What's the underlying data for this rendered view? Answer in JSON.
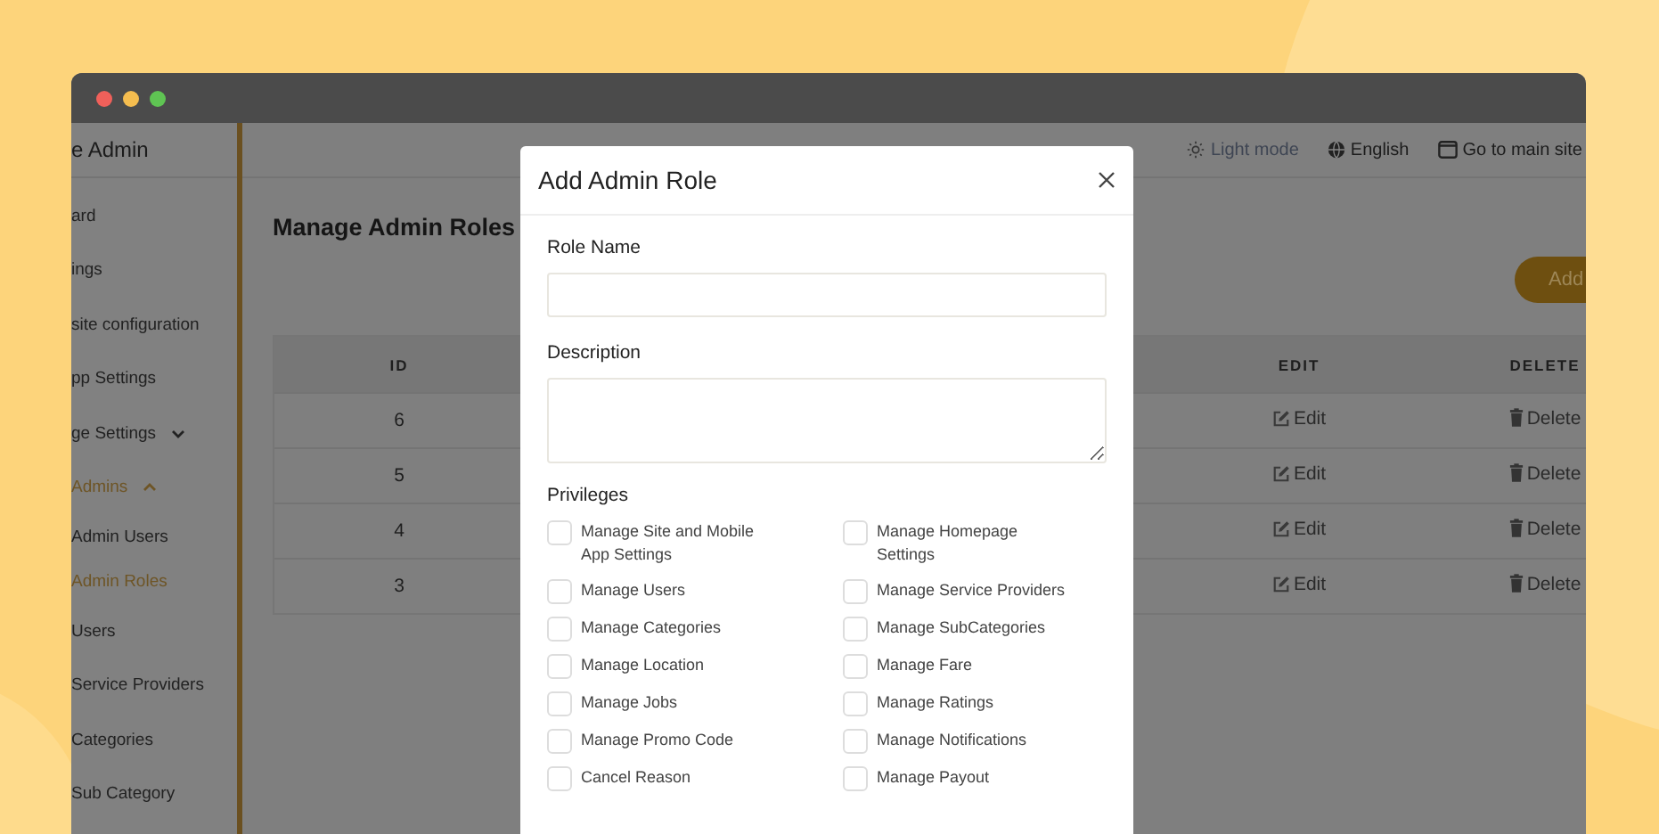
{
  "sidebar": {
    "title": "e Admin",
    "items": [
      {
        "label": "ard",
        "selected": false
      },
      {
        "label": "ings",
        "selected": false
      },
      {
        "label": "site configuration",
        "selected": false
      },
      {
        "label": "pp Settings",
        "selected": false
      },
      {
        "label": "ge Settings",
        "selected": false,
        "expanded": false
      },
      {
        "label": "Admins",
        "selected": true,
        "expanded": true,
        "children": [
          {
            "label": "Admin Users",
            "selected": false
          },
          {
            "label": "Admin Roles",
            "selected": true
          }
        ]
      },
      {
        "label": "Users",
        "selected": false
      },
      {
        "label": "Service Providers",
        "selected": false
      },
      {
        "label": "Categories",
        "selected": false
      },
      {
        "label": "Sub Category",
        "selected": false
      }
    ]
  },
  "topbar": [
    {
      "kind": "theme",
      "label": "Light mode"
    },
    {
      "kind": "language",
      "label": "English"
    },
    {
      "kind": "site",
      "label": "Go to main site"
    }
  ],
  "page": {
    "title": "Manage Admin Roles",
    "add_button": "Add"
  },
  "table": {
    "columns": [
      "ID",
      "EDIT",
      "DELETE"
    ],
    "rows": [
      {
        "id": "6",
        "edit": "Edit",
        "delete": "Delete"
      },
      {
        "id": "5",
        "edit": "Edit",
        "delete": "Delete"
      },
      {
        "id": "4",
        "edit": "Edit",
        "delete": "Delete"
      },
      {
        "id": "3",
        "edit": "Edit",
        "delete": "Delete"
      }
    ]
  },
  "modal": {
    "title": "Add Admin Role",
    "fields": [
      {
        "kind": "input",
        "label": "Role Name"
      },
      {
        "kind": "textarea",
        "label": "Description"
      }
    ],
    "privileges_label": "Privileges",
    "privileges": [
      {
        "label": "Manage Site and Mobile App Settings",
        "checked": false
      },
      {
        "label": "Manage Homepage Settings",
        "checked": false
      },
      {
        "label": "Manage Users",
        "checked": false
      },
      {
        "label": "Manage Service Providers",
        "checked": false
      },
      {
        "label": "Manage Categories",
        "checked": false
      },
      {
        "label": "Manage SubCategories",
        "checked": false
      },
      {
        "label": "Manage Location",
        "checked": false
      },
      {
        "label": "Manage Fare",
        "checked": false
      },
      {
        "label": "Manage Jobs",
        "checked": false
      },
      {
        "label": "Manage Ratings",
        "checked": false
      },
      {
        "label": "Manage Promo Code",
        "checked": false
      },
      {
        "label": "Manage Notifications",
        "checked": false
      },
      {
        "label": "Cancel Reason",
        "checked": false
      },
      {
        "label": "Manage Payout",
        "checked": false
      }
    ]
  }
}
